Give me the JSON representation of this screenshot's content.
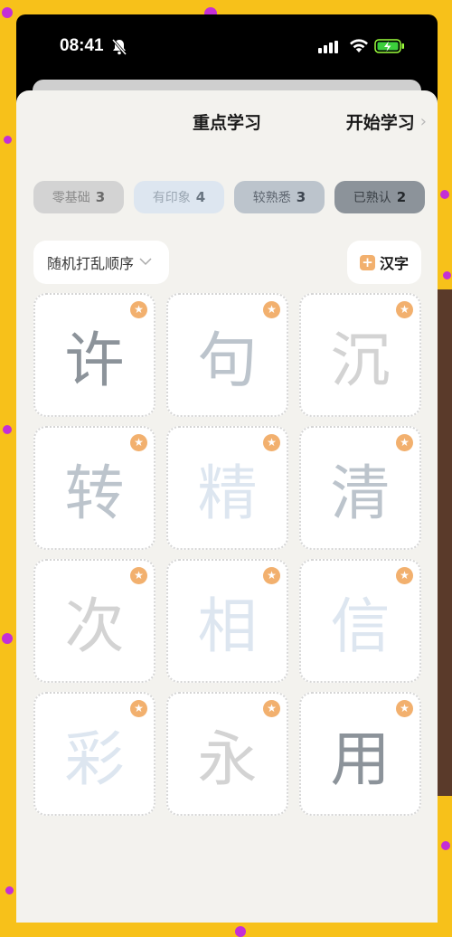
{
  "status_bar": {
    "time": "08:41"
  },
  "header": {
    "title": "重点学习",
    "start_label": "开始学习",
    "chevron": "›"
  },
  "levels": [
    {
      "label": "零基础",
      "count": "3",
      "bg": "#d3d3d3",
      "fg": "#8a8a8a"
    },
    {
      "label": "有印象",
      "count": "4",
      "bg": "#dde6f0",
      "fg": "#9aa6b2"
    },
    {
      "label": "较熟悉",
      "count": "3",
      "bg": "#bcc4cc",
      "fg": "#5e6670"
    },
    {
      "label": "已熟认",
      "count": "2",
      "bg": "#8c939a",
      "fg": "#3c4248"
    }
  ],
  "order_button": {
    "label": "随机打乱顺序",
    "icon": "chevron-down-icon"
  },
  "hanzi_button": {
    "label": "汉字",
    "icon": "plus-icon"
  },
  "cards": [
    {
      "char": "许",
      "color": "#8c939a"
    },
    {
      "char": "句",
      "color": "#bcc4cc"
    },
    {
      "char": "沉",
      "color": "#d3d3d3"
    },
    {
      "char": "转",
      "color": "#bcc4cc"
    },
    {
      "char": "精",
      "color": "#dde6f0"
    },
    {
      "char": "清",
      "color": "#bcc4cc"
    },
    {
      "char": "次",
      "color": "#d3d3d3"
    },
    {
      "char": "相",
      "color": "#dde6f0"
    },
    {
      "char": "信",
      "color": "#dde6f0"
    },
    {
      "char": "彩",
      "color": "#dde6f0"
    },
    {
      "char": "永",
      "color": "#d3d3d3"
    },
    {
      "char": "用",
      "color": "#8c939a"
    }
  ],
  "star_icon": "star-icon",
  "accent": "#f2b06e"
}
